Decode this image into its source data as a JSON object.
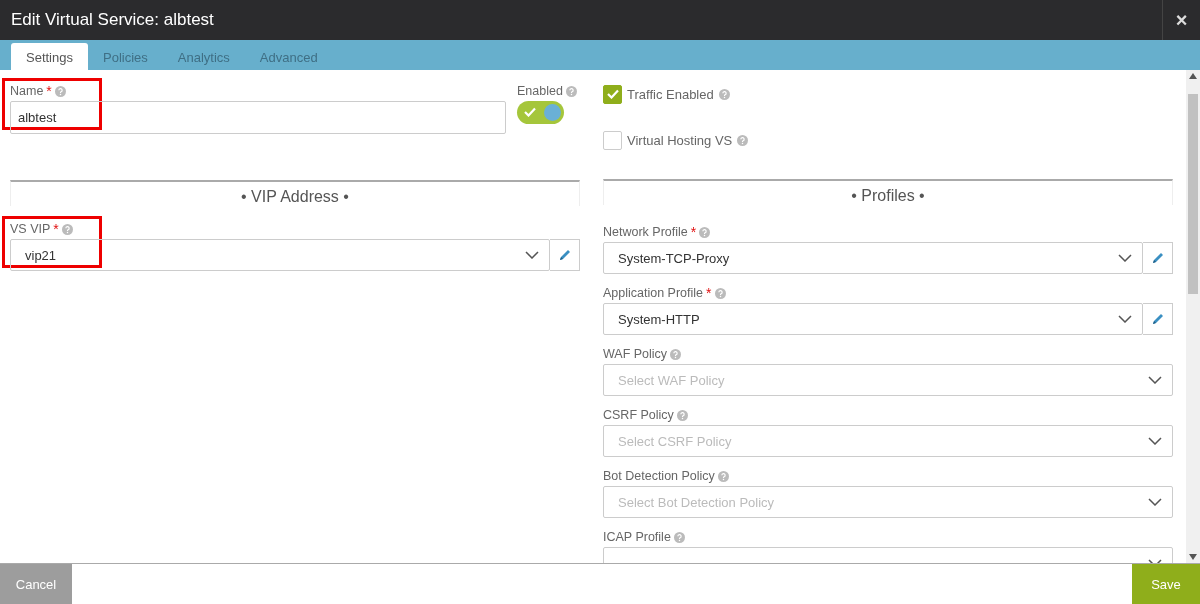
{
  "window": {
    "title": "Edit Virtual Service: albtest",
    "close": "×"
  },
  "tabs": [
    {
      "label": "Settings",
      "selected": true
    },
    {
      "label": "Policies",
      "selected": false
    },
    {
      "label": "Analytics",
      "selected": false
    },
    {
      "label": "Advanced",
      "selected": false
    }
  ],
  "name_field": {
    "label": "Name",
    "required_mark": "*",
    "value": "albtest",
    "highlighted": true
  },
  "enabled_toggle": {
    "label": "Enabled",
    "on": true
  },
  "vip_section": {
    "title": "• VIP Address •"
  },
  "vs_vip_field": {
    "label": "VS VIP",
    "required_mark": "*",
    "value": "vip21",
    "highlighted": true,
    "editable": true
  },
  "options": [
    {
      "label": "Traffic Enabled",
      "checked": true
    },
    {
      "label": "Virtual Hosting VS",
      "checked": false
    }
  ],
  "profiles_section": {
    "title": "• Profiles •"
  },
  "profile_fields": [
    {
      "label": "Network Profile",
      "required_mark": "*",
      "value": "System-TCP-Proxy",
      "editable": true
    },
    {
      "label": "Application Profile",
      "required_mark": "*",
      "value": "System-HTTP",
      "editable": true
    },
    {
      "label": "WAF Policy",
      "placeholder": "Select WAF Policy",
      "editable": false
    },
    {
      "label": "CSRF Policy",
      "placeholder": "Select CSRF Policy",
      "editable": false
    },
    {
      "label": "Bot Detection Policy",
      "placeholder": "Select Bot Detection Policy",
      "editable": false
    },
    {
      "label": "ICAP Profile",
      "editable": false
    }
  ],
  "footer": {
    "cancel": "Cancel",
    "save": "Save"
  }
}
